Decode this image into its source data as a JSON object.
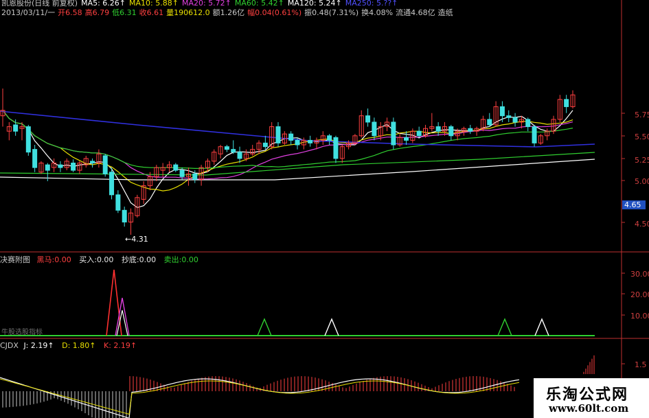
{
  "colors": {
    "up": "#ff4040",
    "down": "#40e0e0",
    "bg": "#000000",
    "axis": "#c03030",
    "ma5": "#ffffff",
    "ma10": "#e8e000",
    "ma20": "#e040e0",
    "ma60": "#30d030",
    "ma120": "#ffffff",
    "ma250": "#3030e0"
  },
  "header": {
    "title": "凯恩股份(日线 前复权)",
    "ma5": "MA5: 6.26↑",
    "ma10": "MA10: 5.88↑",
    "ma20": "MA20: 5.72↑",
    "ma60": "MA60: 5.42↑",
    "ma120": "MA120: 5.24↑",
    "ma250": "MA250: 5.??↑",
    "line2": [
      {
        "t": "2013/03/11/一",
        "c": "#c8c8c8"
      },
      {
        "t": "开6.58",
        "c": "#ff4040"
      },
      {
        "t": "高6.79",
        "c": "#ff4040"
      },
      {
        "t": "低6.31",
        "c": "#30d030"
      },
      {
        "t": "收6.61",
        "c": "#ff4040"
      },
      {
        "t": "量190612.0",
        "c": "#e8e000"
      },
      {
        "t": "额1.26亿",
        "c": "#c8c8c8"
      },
      {
        "t": "幅0.04(0.61%)",
        "c": "#ff4040"
      },
      {
        "t": "振0.48(7.31%)",
        "c": "#c8c8c8"
      },
      {
        "t": "换4.08%",
        "c": "#c8c8c8"
      },
      {
        "t": "流通4.68亿",
        "c": "#c8c8c8"
      },
      {
        "t": "造纸",
        "c": "#c8c8c8"
      }
    ]
  },
  "price_axis": {
    "labels": [
      "5.75",
      "5.50",
      "5.25",
      "5.00",
      "4.65",
      "4.50"
    ],
    "current": "4.65",
    "min_marker": "4.31"
  },
  "indicator1": {
    "name": "决赛附图",
    "heima_label": "黑马:",
    "heima_value": "0.00",
    "buy_label": "买入:",
    "buy_value": "0.00",
    "dip_label": "抄底:",
    "dip_value": "0.00",
    "sell_label": "卖出:",
    "sell_value": "0.00",
    "axis": [
      "30.00",
      "20.00",
      "10.00"
    ],
    "footnote": "牛股选股指标"
  },
  "indicator2": {
    "name": "CJDX",
    "j": "J: 2.19↑",
    "d": "D: 1.80↑",
    "k": "K: 2.19↑",
    "axis": [
      "1.5"
    ]
  },
  "watermark": {
    "line1": "乐淘公式网",
    "line2": "www.60lt.com"
  },
  "chart_data": {
    "type": "candlestick",
    "ylim": [
      4.25,
      5.95
    ],
    "candles": [
      [
        5.62,
        5.92,
        5.5,
        5.68
      ],
      [
        5.45,
        5.55,
        5.35,
        5.5
      ],
      [
        5.52,
        5.58,
        5.4,
        5.45
      ],
      [
        5.48,
        5.55,
        5.35,
        5.5
      ],
      [
        5.5,
        5.52,
        5.18,
        5.22
      ],
      [
        5.25,
        5.3,
        5.0,
        5.05
      ],
      [
        5.0,
        5.12,
        4.98,
        5.1
      ],
      [
        5.08,
        5.1,
        4.9,
        5.02
      ],
      [
        5.05,
        5.15,
        5.0,
        5.1
      ],
      [
        5.08,
        5.12,
        5.0,
        5.05
      ],
      [
        5.05,
        5.15,
        5.02,
        5.12
      ],
      [
        5.1,
        5.14,
        5.0,
        5.02
      ],
      [
        5.02,
        5.12,
        4.98,
        5.1
      ],
      [
        5.08,
        5.18,
        5.05,
        5.15
      ],
      [
        5.12,
        5.15,
        5.05,
        5.1
      ],
      [
        5.1,
        5.25,
        5.05,
        5.2
      ],
      [
        5.18,
        5.2,
        4.95,
        4.98
      ],
      [
        5.0,
        5.05,
        4.7,
        4.75
      ],
      [
        4.75,
        4.8,
        4.55,
        4.58
      ],
      [
        4.58,
        4.62,
        4.4,
        4.45
      ],
      [
        4.45,
        4.6,
        4.31,
        4.55
      ],
      [
        4.52,
        4.75,
        4.5,
        4.72
      ],
      [
        4.7,
        4.9,
        4.65,
        4.85
      ],
      [
        4.85,
        5.0,
        4.8,
        4.95
      ],
      [
        4.95,
        5.08,
        4.9,
        5.05
      ],
      [
        5.02,
        5.1,
        4.95,
        5.05
      ],
      [
        5.05,
        5.12,
        5.0,
        5.08
      ],
      [
        5.08,
        5.1,
        5.0,
        5.02
      ],
      [
        5.02,
        5.05,
        4.92,
        4.95
      ],
      [
        4.95,
        5.05,
        4.85,
        4.98
      ],
      [
        4.98,
        5.02,
        4.88,
        4.92
      ],
      [
        4.92,
        5.08,
        4.85,
        5.05
      ],
      [
        5.05,
        5.15,
        5.0,
        5.12
      ],
      [
        5.12,
        5.25,
        5.08,
        5.22
      ],
      [
        5.2,
        5.3,
        5.15,
        5.28
      ],
      [
        5.28,
        5.3,
        5.22,
        5.25
      ],
      [
        5.25,
        5.35,
        5.2,
        5.22
      ],
      [
        5.22,
        5.28,
        5.1,
        5.15
      ],
      [
        5.15,
        5.25,
        5.12,
        5.2
      ],
      [
        5.2,
        5.3,
        5.18,
        5.25
      ],
      [
        5.25,
        5.35,
        5.2,
        5.32
      ],
      [
        5.32,
        5.4,
        5.25,
        5.28
      ],
      [
        5.28,
        5.55,
        5.25,
        5.5
      ],
      [
        5.5,
        5.55,
        5.28,
        5.32
      ],
      [
        5.32,
        5.45,
        5.3,
        5.42
      ],
      [
        5.42,
        5.45,
        5.3,
        5.35
      ],
      [
        5.35,
        5.38,
        5.25,
        5.3
      ],
      [
        5.3,
        5.38,
        5.25,
        5.35
      ],
      [
        5.35,
        5.4,
        5.28,
        5.32
      ],
      [
        5.32,
        5.38,
        5.25,
        5.35
      ],
      [
        5.35,
        5.45,
        5.3,
        5.4
      ],
      [
        5.4,
        5.42,
        5.3,
        5.35
      ],
      [
        5.38,
        5.4,
        5.1,
        5.15
      ],
      [
        5.15,
        5.3,
        5.1,
        5.28
      ],
      [
        5.28,
        5.35,
        5.25,
        5.32
      ],
      [
        5.32,
        5.42,
        5.3,
        5.4
      ],
      [
        5.4,
        5.68,
        5.38,
        5.62
      ],
      [
        5.62,
        5.7,
        5.5,
        5.55
      ],
      [
        5.55,
        5.6,
        5.35,
        5.4
      ],
      [
        5.4,
        5.55,
        5.35,
        5.5
      ],
      [
        5.5,
        5.6,
        5.45,
        5.55
      ],
      [
        5.55,
        5.6,
        5.25,
        5.3
      ],
      [
        5.3,
        5.42,
        5.28,
        5.38
      ],
      [
        5.38,
        5.45,
        5.3,
        5.35
      ],
      [
        5.35,
        5.48,
        5.32,
        5.45
      ],
      [
        5.45,
        5.5,
        5.38,
        5.4
      ],
      [
        5.4,
        5.52,
        5.38,
        5.48
      ],
      [
        5.48,
        5.65,
        5.45,
        5.5
      ],
      [
        5.5,
        5.55,
        5.4,
        5.45
      ],
      [
        5.45,
        5.55,
        5.4,
        5.5
      ],
      [
        5.5,
        5.52,
        5.35,
        5.4
      ],
      [
        5.4,
        5.48,
        5.35,
        5.45
      ],
      [
        5.45,
        5.5,
        5.4,
        5.48
      ],
      [
        5.48,
        5.52,
        5.42,
        5.45
      ],
      [
        5.45,
        5.5,
        5.4,
        5.48
      ],
      [
        5.48,
        5.62,
        5.45,
        5.58
      ],
      [
        5.58,
        5.65,
        5.5,
        5.52
      ],
      [
        5.52,
        5.78,
        5.5,
        5.72
      ],
      [
        5.72,
        5.78,
        5.55,
        5.62
      ],
      [
        5.62,
        5.68,
        5.55,
        5.6
      ],
      [
        5.6,
        5.65,
        5.5,
        5.55
      ],
      [
        5.55,
        5.62,
        5.48,
        5.58
      ],
      [
        5.58,
        5.6,
        5.45,
        5.5
      ],
      [
        5.5,
        5.52,
        5.28,
        5.32
      ],
      [
        5.32,
        5.42,
        5.3,
        5.4
      ],
      [
        5.4,
        5.48,
        5.35,
        5.45
      ],
      [
        5.45,
        5.62,
        5.42,
        5.58
      ],
      [
        5.58,
        5.85,
        5.55,
        5.8
      ],
      [
        5.8,
        5.85,
        5.65,
        5.72
      ],
      [
        5.72,
        5.9,
        5.7,
        5.85
      ]
    ]
  }
}
